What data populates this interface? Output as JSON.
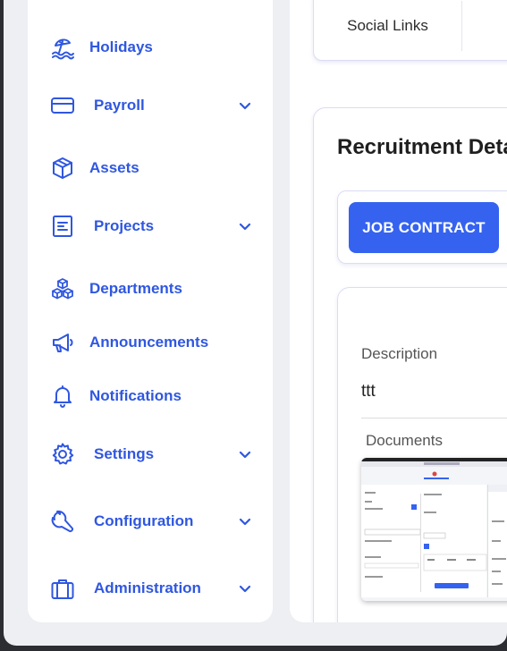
{
  "sidebar": {
    "items": [
      {
        "label": "Holidays",
        "icon": "beach-umbrella-icon",
        "has_chevron": false
      },
      {
        "label": "Payroll",
        "icon": "credit-card-icon",
        "has_chevron": true
      },
      {
        "label": "Assets",
        "icon": "cube-icon",
        "has_chevron": false
      },
      {
        "label": "Projects",
        "icon": "document-list-icon",
        "has_chevron": true
      },
      {
        "label": "Departments",
        "icon": "cubes-stack-icon",
        "has_chevron": false
      },
      {
        "label": "Announcements",
        "icon": "megaphone-icon",
        "has_chevron": false
      },
      {
        "label": "Notifications",
        "icon": "bell-icon",
        "has_chevron": false
      },
      {
        "label": "Settings",
        "icon": "gear-icon",
        "has_chevron": true
      },
      {
        "label": "Configuration",
        "icon": "wrench-icon",
        "has_chevron": true
      },
      {
        "label": "Administration",
        "icon": "briefcase-icon",
        "has_chevron": true
      }
    ],
    "accent_color": "#2f57e0"
  },
  "main": {
    "social_links_label": "Social Links",
    "recruitment_title": "Recruitment Deta",
    "tabs": [
      {
        "label": "JOB CONTRACT",
        "active": true
      }
    ],
    "description_label": "Description",
    "description_value": "ttt",
    "documents_label": "Documents",
    "primary_color": "#3563f0"
  }
}
